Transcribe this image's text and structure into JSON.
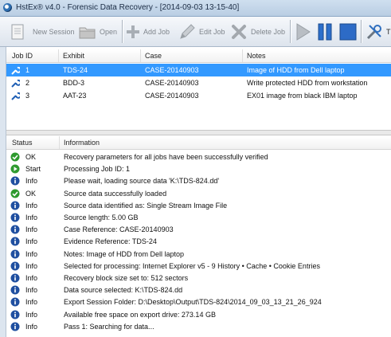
{
  "window": {
    "title": "HstEx® v4.0 - Forensic Data Recovery - [2014-09-03 13-15-40]"
  },
  "toolbar": {
    "new_session": "New Session",
    "open": "Open",
    "add_job": "Add Job",
    "edit_job": "Edit Job",
    "delete_job": "Delete Job",
    "partial_label": "T"
  },
  "jobs": {
    "headers": {
      "job_id": "Job ID",
      "exhibit": "Exhibit",
      "case": "Case",
      "notes": "Notes"
    },
    "rows": [
      {
        "job_id": "1",
        "exhibit": "TDS-24",
        "case": "CASE-20140903",
        "notes": "Image of HDD from Dell laptop",
        "selected": true
      },
      {
        "job_id": "2",
        "exhibit": "BDD-3",
        "case": "CASE-20140903",
        "notes": "Write protected HDD from workstation",
        "selected": false
      },
      {
        "job_id": "3",
        "exhibit": "AAT-23",
        "case": "CASE-20140903",
        "notes": "EX01 image from black IBM laptop",
        "selected": false
      }
    ]
  },
  "log": {
    "headers": {
      "status": "Status",
      "information": "Information"
    },
    "rows": [
      {
        "icon": "check-icon",
        "status": "OK",
        "info": "Recovery parameters for all jobs have been successfully verified"
      },
      {
        "icon": "play-icon",
        "status": "Start",
        "info": "Processing Job ID: 1"
      },
      {
        "icon": "info-icon",
        "status": "Info",
        "info": "Please wait, loading source data 'K:\\TDS-824.dd'"
      },
      {
        "icon": "check-icon",
        "status": "OK",
        "info": "Source data successfully loaded"
      },
      {
        "icon": "info-icon",
        "status": "Info",
        "info": "Source data identified as: Single Stream Image File"
      },
      {
        "icon": "info-icon",
        "status": "Info",
        "info": "Source length: 5.00 GB"
      },
      {
        "icon": "info-icon",
        "status": "Info",
        "info": "Case Reference: CASE-20140903"
      },
      {
        "icon": "info-icon",
        "status": "Info",
        "info": "Evidence Reference: TDS-24"
      },
      {
        "icon": "info-icon",
        "status": "Info",
        "info": "Notes: Image of HDD from Dell laptop"
      },
      {
        "icon": "info-icon",
        "status": "Info",
        "info": "Selected for processing: Internet Explorer v5 - 9 History • Cache • Cookie Entries"
      },
      {
        "icon": "info-icon",
        "status": "Info",
        "info": "Recovery block size set to: 512 sectors"
      },
      {
        "icon": "info-icon",
        "status": "Info",
        "info": "Data source selected: K:\\TDS-824.dd"
      },
      {
        "icon": "info-icon",
        "status": "Info",
        "info": "Export Session Folder: D:\\Desktop\\Output\\TDS-824\\2014_09_03_13_21_26_924"
      },
      {
        "icon": "info-icon",
        "status": "Info",
        "info": "Available free space on export drive: 273.14 GB"
      },
      {
        "icon": "info-icon",
        "status": "Info",
        "info": "Pass 1: Searching for data..."
      }
    ]
  },
  "colors": {
    "selection": "#3399ff",
    "ok_green": "#2e9a2e",
    "info_blue": "#1f4fa0",
    "stop_blue": "#1e5fbf"
  }
}
